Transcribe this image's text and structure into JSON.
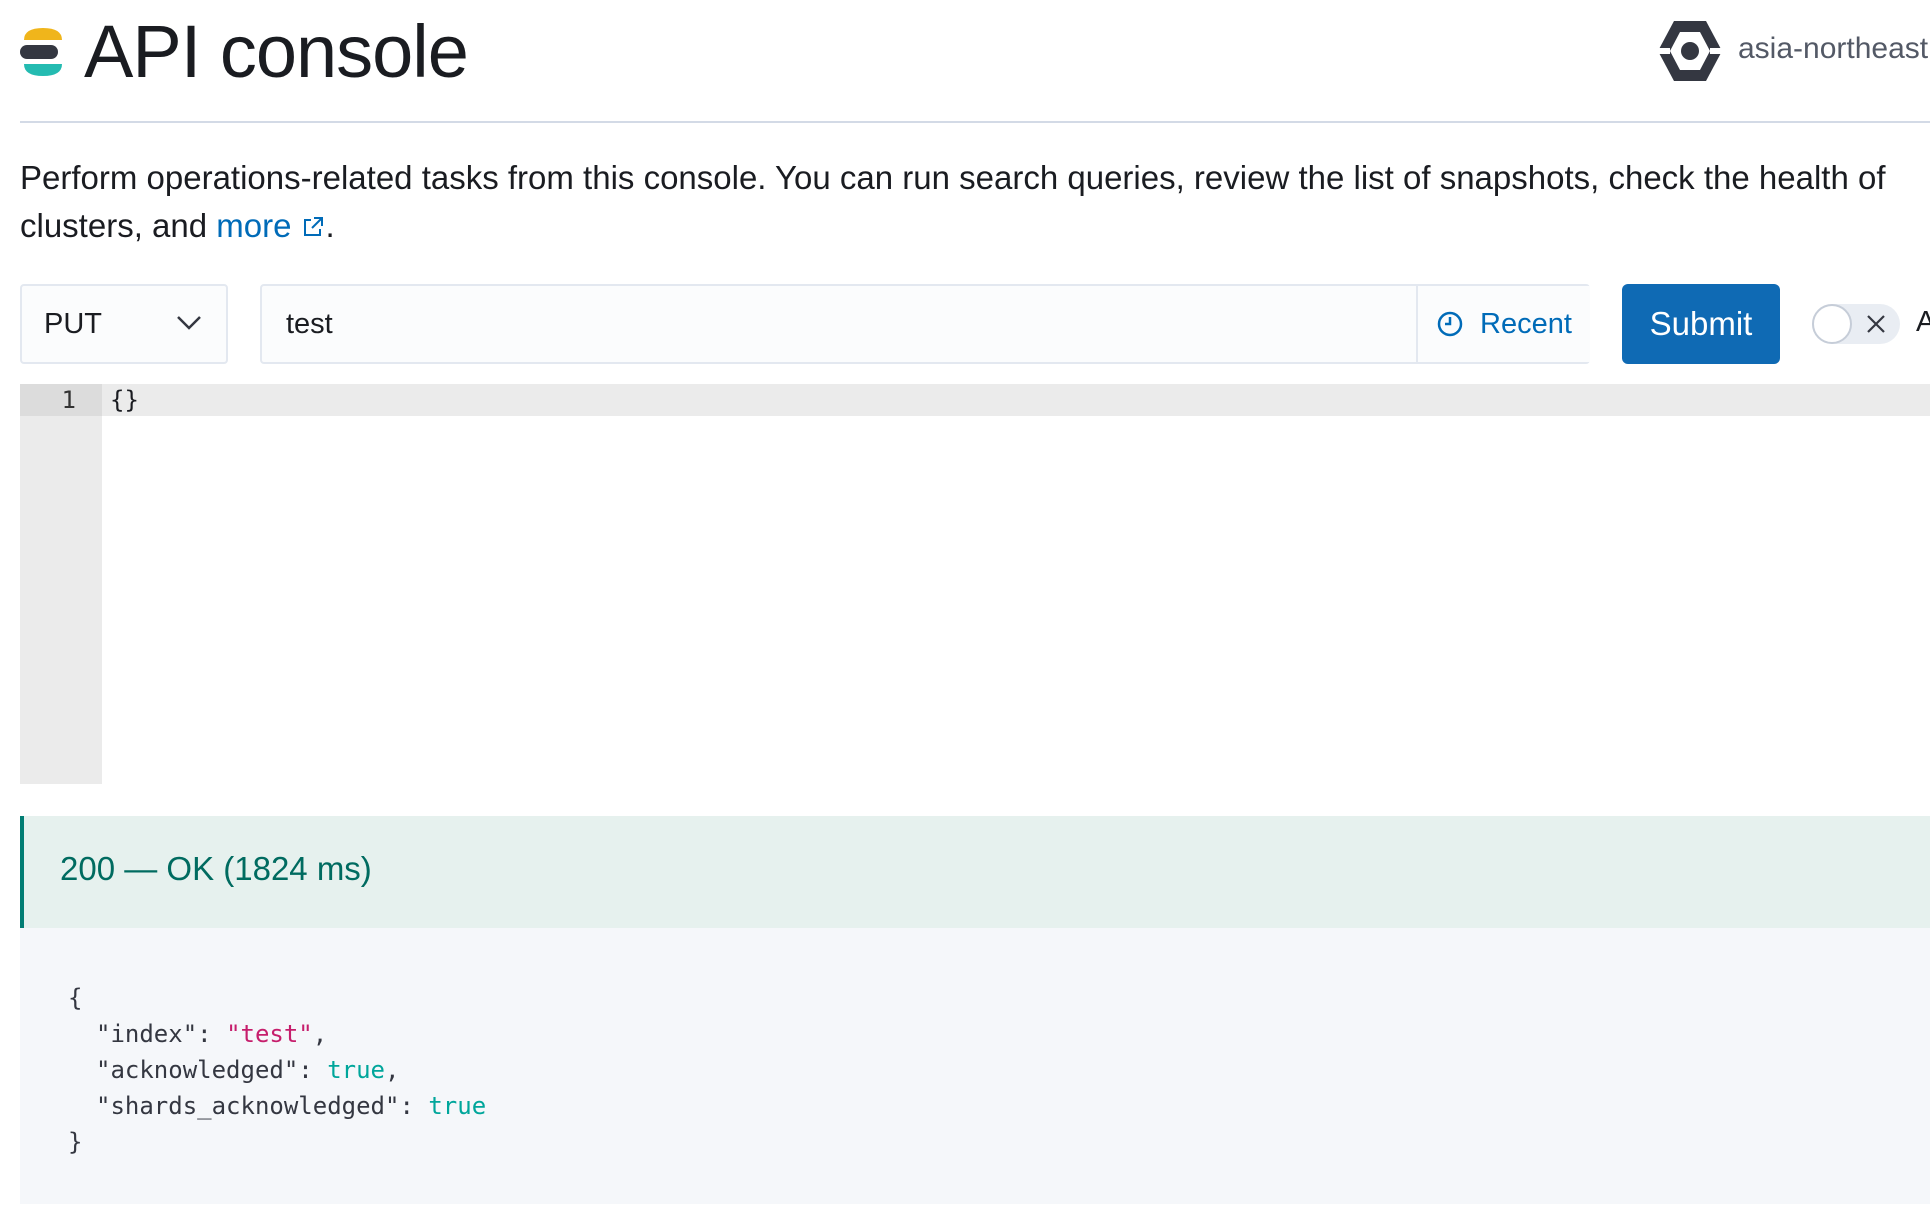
{
  "header": {
    "title": "API console",
    "region": "asia-northeast"
  },
  "description": {
    "line1": "Perform operations-related tasks from this console. You can run search queries, review the list of snapshots, check the health of",
    "line2_prefix": "clusters, and ",
    "link_text": "more",
    "line2_suffix": "."
  },
  "request": {
    "method": "PUT",
    "path": "test",
    "recent_label": "Recent",
    "submit_label": "Submit",
    "toggle_label": "A"
  },
  "editor": {
    "lines": [
      {
        "number": "1",
        "text": "{}"
      }
    ]
  },
  "response": {
    "status": "200 — OK (1824 ms)",
    "open_brace": "{",
    "close_brace": "}",
    "fields": [
      {
        "key": "\"index\"",
        "value": "\"test\"",
        "kind": "string",
        "trail": ","
      },
      {
        "key": "\"acknowledged\"",
        "value": "true",
        "kind": "bool",
        "trail": ","
      },
      {
        "key": "\"shards_acknowledged\"",
        "value": "true",
        "kind": "bool",
        "trail": ""
      }
    ]
  },
  "colors": {
    "accent": "#006bb8",
    "submit": "#0f6ab4",
    "success": "#017d73",
    "json_string": "#c61e6c",
    "json_bool": "#00a69b"
  },
  "icons": {
    "logo": "elastic-logo-icon",
    "region": "gcp-hexagon-icon",
    "external_link": "external-link-icon",
    "method_chevron": "chevron-down-icon",
    "recent": "clock-icon",
    "toggle": "close-icon"
  }
}
